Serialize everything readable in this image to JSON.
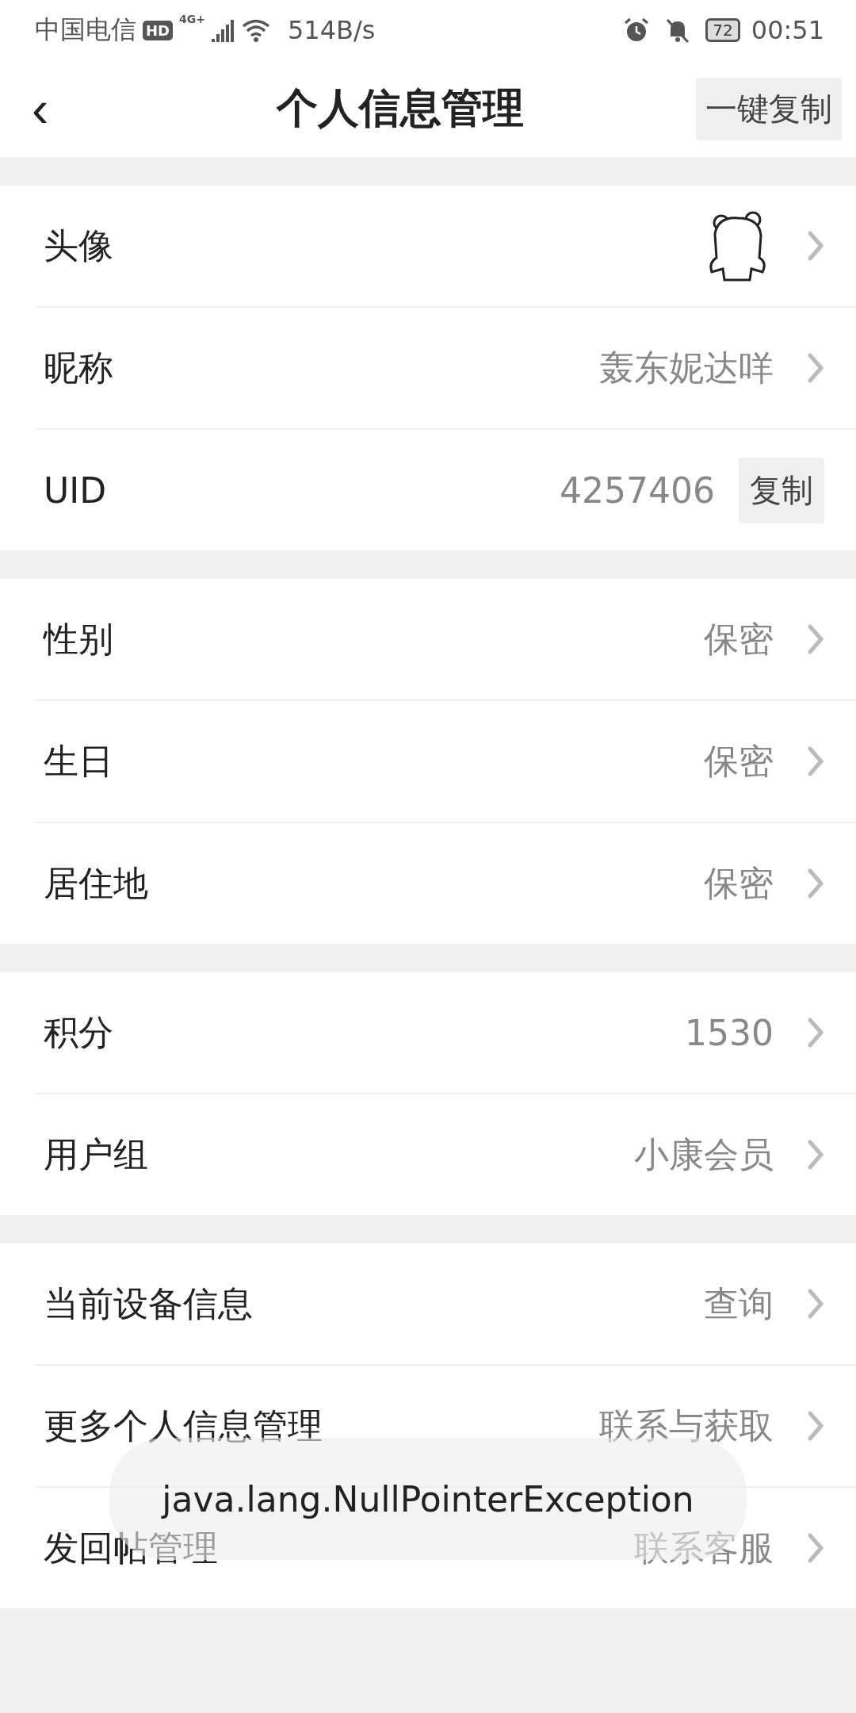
{
  "status_bar": {
    "carrier": "中国电信",
    "hd": "HD",
    "network": "4G+",
    "speed": "514B/s",
    "battery": "72",
    "time": "00:51"
  },
  "header": {
    "back": "‹",
    "title": "个人信息管理",
    "action": "一键复制"
  },
  "sections": [
    {
      "rows": [
        {
          "kind": "avatar",
          "label": "头像"
        },
        {
          "kind": "value",
          "label": "昵称",
          "value": "轰东妮达咩"
        },
        {
          "kind": "copy",
          "label": "UID",
          "value": "4257406",
          "button": "复制"
        }
      ]
    },
    {
      "rows": [
        {
          "kind": "value",
          "label": "性别",
          "value": "保密"
        },
        {
          "kind": "value",
          "label": "生日",
          "value": "保密"
        },
        {
          "kind": "value",
          "label": "居住地",
          "value": "保密"
        }
      ]
    },
    {
      "rows": [
        {
          "kind": "value",
          "label": "积分",
          "value": "1530"
        },
        {
          "kind": "value",
          "label": "用户组",
          "value": "小康会员"
        }
      ]
    },
    {
      "rows": [
        {
          "kind": "value",
          "label": "当前设备信息",
          "value": "查询"
        },
        {
          "kind": "value",
          "label": "更多个人信息管理",
          "value": "联系与获取"
        },
        {
          "kind": "value",
          "label": "发回帖管理",
          "value": "联系客服"
        }
      ]
    }
  ],
  "toast": {
    "text": "java.lang.NullPointerException"
  }
}
